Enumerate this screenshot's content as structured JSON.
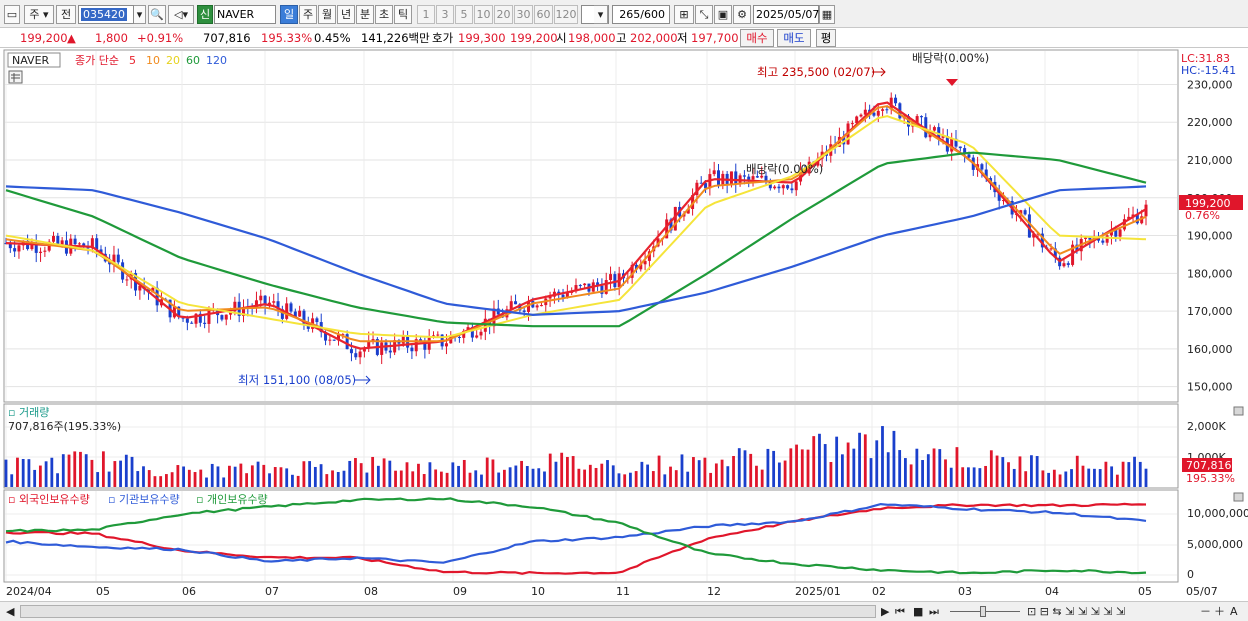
{
  "toolbar": {
    "period_label": "주",
    "prev_label": "전",
    "stock_code": "035420",
    "new_badge": "신",
    "stock_name": "NAVER",
    "period_buttons": [
      "일",
      "주",
      "월",
      "년",
      "분",
      "초",
      "틱"
    ],
    "minute_buttons": [
      "1",
      "3",
      "5",
      "10",
      "20",
      "30",
      "60",
      "120"
    ],
    "count_value": "265",
    "count_total": "/600",
    "date_value": "2025/05/07"
  },
  "quote": {
    "price": "199,200",
    "arrow": "▲",
    "change": "1,800",
    "change_pct": "+0.91%",
    "volume": "707,816",
    "volume_ratio": "195.33%",
    "turnover": "0.45%",
    "trade_value": "141,226백만",
    "hoga_label": "호가",
    "hoga_ask": "199,300",
    "hoga_bid": "199,200",
    "open_label": "시",
    "open": "198,000",
    "high_label": "고",
    "high": "202,000",
    "low_label": "저",
    "low": "197,700",
    "buy_label": "매수",
    "sell_label": "매도",
    "eval_label": "평"
  },
  "price_panel": {
    "name_tag": "NAVER",
    "legend_prefix": "종가 단순",
    "ma_periods": [
      "5",
      "10",
      "20",
      "60",
      "120"
    ],
    "ma_colors": [
      "#e8232d",
      "#f08a1d",
      "#f5e43a",
      "#1f9a3a",
      "#2f5bd8"
    ],
    "lc_label": "LC:31.83",
    "hc_label": "HC:-15.41",
    "current_price": "199,200",
    "current_pct": "0.76%",
    "y_ticks": [
      "230,000",
      "220,000",
      "210,000",
      "200,000",
      "190,000",
      "180,000",
      "170,000",
      "160,000",
      "150,000"
    ],
    "annotation_high": "최고 235,500 (02/07)",
    "annotation_low": "최저 151,100 (08/05)",
    "annotation_div1": "배당락(0.00%)",
    "annotation_div2": "배당락(0.00%)"
  },
  "volume_panel": {
    "title": "거래량",
    "value_label": "707,816주(195.33%)",
    "y_ticks": [
      "2,000K",
      "1,000K"
    ],
    "current": "707,816",
    "current_pct": "195.33%"
  },
  "holdings_panel": {
    "legend": [
      "외국인보유수량",
      "기관보유수량",
      "개인보유수량"
    ],
    "colors": [
      "#e0162b",
      "#2f5bd8",
      "#1f9a3a"
    ],
    "y_ticks": [
      "10,000,000",
      "5,000,000",
      "0"
    ]
  },
  "x_axis": [
    "2024/04",
    "05",
    "06",
    "07",
    "08",
    "09",
    "10",
    "11",
    "12",
    "2025/01",
    "02",
    "03",
    "04",
    "05",
    "05/07"
  ],
  "chart_data": {
    "type": "line",
    "title": "NAVER",
    "ylabel": "",
    "ylim": [
      147000,
      237000
    ],
    "x": [
      "2024/04",
      "2024/05",
      "2024/06",
      "2024/07",
      "2024/08",
      "2024/09",
      "2024/10",
      "2024/11",
      "2024/12",
      "2025/01",
      "2025/02",
      "2025/03",
      "2025/04",
      "2025/05"
    ],
    "series": [
      {
        "name": "5",
        "values": [
          188000,
          187000,
          168000,
          172000,
          160000,
          162000,
          173000,
          178000,
          205000,
          204000,
          226000,
          210000,
          183000,
          197000
        ]
      },
      {
        "name": "10",
        "values": [
          189000,
          186000,
          170000,
          171000,
          162000,
          162000,
          172000,
          176000,
          203000,
          205000,
          225000,
          210000,
          185000,
          195000
        ]
      },
      {
        "name": "20",
        "values": [
          190000,
          186000,
          172000,
          168000,
          164000,
          163000,
          169000,
          173000,
          198000,
          206000,
          222000,
          214000,
          190000,
          189000
        ]
      },
      {
        "name": "60",
        "values": [
          202000,
          195000,
          184000,
          177000,
          171000,
          167000,
          166000,
          166000,
          180000,
          195000,
          209000,
          212000,
          210000,
          204000
        ]
      },
      {
        "name": "120",
        "values": [
          203000,
          202000,
          196000,
          189000,
          180000,
          172000,
          169000,
          170000,
          175000,
          182000,
          190000,
          195000,
          202000,
          203000
        ]
      }
    ],
    "volume_k": [
      680,
      900,
      520,
      610,
      760,
      640,
      880,
      700,
      820,
      1150,
      1480,
      900,
      760,
      707
    ],
    "holdings_millions": {
      "외국인보유수량": [
        7.0,
        6.8,
        4.0,
        2.9,
        2.8,
        0.5,
        0.3,
        0.4,
        6.0,
        8.8,
        11.0,
        11.5,
        11.4,
        11.6
      ],
      "기관보유수량": [
        5.5,
        4.6,
        4.2,
        2.2,
        2.8,
        2.0,
        5.5,
        6.2,
        8.0,
        8.8,
        11.6,
        10.8,
        10.2,
        8.8
      ],
      "개인보유수량": [
        7.2,
        7.4,
        10.0,
        11.2,
        12.3,
        12.5,
        11.2,
        8.5,
        3.5,
        1.8,
        0.8,
        0.3,
        0.8,
        0.4
      ]
    },
    "high_annotation": {
      "date": "2025/02/07",
      "value": 235500
    },
    "low_annotation": {
      "date": "2024/08/05",
      "value": 151100
    }
  }
}
